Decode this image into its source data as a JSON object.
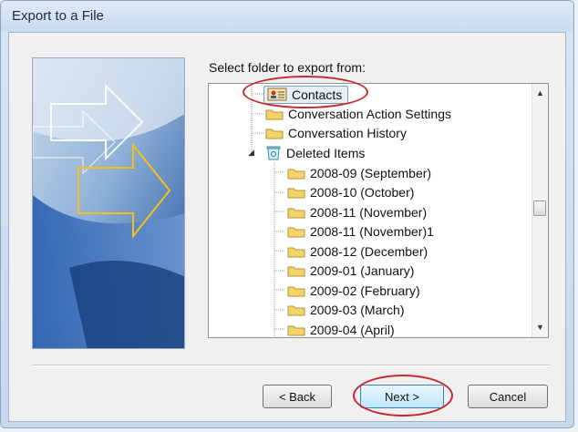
{
  "window": {
    "title": "Export to a File"
  },
  "dialog": {
    "prompt": "Select folder to export from:"
  },
  "tree": {
    "items": [
      {
        "label": "Contacts",
        "icon": "contacts-icon",
        "selected": true,
        "level": 1
      },
      {
        "label": "Conversation Action Settings",
        "icon": "folder-icon",
        "level": 1
      },
      {
        "label": "Conversation History",
        "icon": "folder-icon",
        "level": 1
      },
      {
        "label": "Deleted Items",
        "icon": "deleted-items-icon",
        "expanded": true,
        "level": 1
      },
      {
        "label": "2008-09 (September)",
        "icon": "folder-icon",
        "level": 2
      },
      {
        "label": "2008-10 (October)",
        "icon": "folder-icon",
        "level": 2
      },
      {
        "label": "2008-11 (November)",
        "icon": "folder-icon",
        "level": 2
      },
      {
        "label": "2008-11 (November)1",
        "icon": "folder-icon",
        "level": 2
      },
      {
        "label": "2008-12 (December)",
        "icon": "folder-icon",
        "level": 2
      },
      {
        "label": "2009-01 (January)",
        "icon": "folder-icon",
        "level": 2
      },
      {
        "label": "2009-02 (February)",
        "icon": "folder-icon",
        "level": 2
      },
      {
        "label": "2009-03 (March)",
        "icon": "folder-icon",
        "level": 2
      },
      {
        "label": "2009-04 (April)",
        "icon": "folder-icon",
        "level": 2
      }
    ]
  },
  "buttons": {
    "back": "< Back",
    "next": "Next >",
    "cancel": "Cancel"
  },
  "colors": {
    "highlight_ellipse": "#c6282e",
    "folder_yellow": "#f4d36b"
  }
}
